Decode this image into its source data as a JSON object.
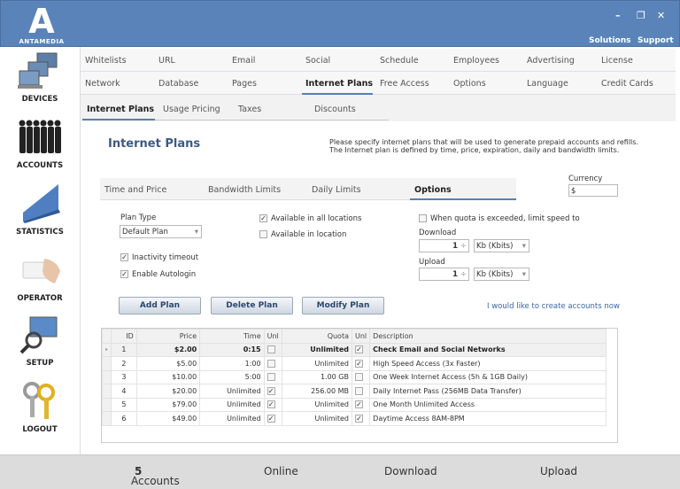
{
  "app": {
    "logo_text": "ANTAMEDIA",
    "links": [
      "Solutions",
      "Support"
    ]
  },
  "window_controls": [
    "minimize-icon",
    "restore-icon",
    "close-icon"
  ],
  "sidebar": [
    {
      "label": "DEVICES",
      "icon": "devices-icon"
    },
    {
      "label": "ACCOUNTS",
      "icon": "accounts-icon"
    },
    {
      "label": "STATISTICS",
      "icon": "statistics-icon"
    },
    {
      "label": "OPERATOR",
      "icon": "operator-icon"
    },
    {
      "label": "SETUP",
      "icon": "setup-icon"
    },
    {
      "label": "LOGOUT",
      "icon": "logout-icon"
    }
  ],
  "nav_row1": [
    "Whitelists",
    "URL",
    "Email",
    "Social",
    "Schedule",
    "Employees",
    "Advertising",
    "License"
  ],
  "nav_row2": [
    "Network",
    "Database",
    "Pages",
    "Internet Plans",
    "Free Access",
    "Options",
    "Language",
    "Credit Cards"
  ],
  "nav_active": "Internet Plans",
  "subtabs": [
    "Internet Plans",
    "Usage Pricing",
    "Taxes",
    "Discounts"
  ],
  "page": {
    "title": "Internet Plans",
    "description": [
      "Please specify internet plans that will be used to generate prepaid accounts and refills.",
      "The Internet plan is defined by time, price, expiration, daily and bandwidth limits."
    ]
  },
  "option_tabs": [
    "Time and Price",
    "Bandwidth Limits",
    "Daily Limits",
    "Options"
  ],
  "option_tab_active": "Options",
  "currency": {
    "label": "Currency",
    "value": "$"
  },
  "options": {
    "plan_type_label": "Plan Type",
    "plan_type_value": "Default Plan",
    "inactivity_timeout": {
      "label": "Inactivity timeout",
      "checked": true
    },
    "enable_autologin": {
      "label": "Enable Autologin",
      "checked": true
    },
    "all_locations": {
      "label": "Available in all locations",
      "checked": true
    },
    "in_location": {
      "label": "Available in location",
      "checked": false
    },
    "limit_speed": {
      "label": "When quota is exceeded, limit speed to",
      "checked": false
    },
    "download_label": "Download",
    "download_value": "1",
    "download_unit": "Kb (Kbits)",
    "upload_label": "Upload",
    "upload_value": "1",
    "upload_unit": "Kb (Kbits)"
  },
  "buttons": {
    "add": "Add Plan",
    "delete": "Delete Plan",
    "modify": "Modify Plan",
    "create_link": "I would like to create accounts now"
  },
  "table": {
    "columns": [
      "ID",
      "Price",
      "Time",
      "Unl",
      "Quota",
      "Unl",
      "Description"
    ],
    "rows": [
      {
        "id": "1",
        "price": "$2.00",
        "time": "0:15",
        "time_unl": false,
        "quota": "Unlimited",
        "quota_unl": true,
        "desc": "Check Email and Social Networks"
      },
      {
        "id": "2",
        "price": "$5.00",
        "time": "1:00",
        "time_unl": false,
        "quota": "Unlimited",
        "quota_unl": true,
        "desc": "High Speed Access (3x Faster)"
      },
      {
        "id": "3",
        "price": "$10.00",
        "time": "5:00",
        "time_unl": false,
        "quota": "1.00 GB",
        "quota_unl": false,
        "desc": "One Week Internet Access (5h & 1GB Daily)"
      },
      {
        "id": "4",
        "price": "$20.00",
        "time": "Unlimited",
        "time_unl": true,
        "quota": "256.00 MB",
        "quota_unl": false,
        "desc": "Daily Internet Pass (256MB Data Transfer)"
      },
      {
        "id": "5",
        "price": "$79.00",
        "time": "Unlimited",
        "time_unl": true,
        "quota": "Unlimited",
        "quota_unl": true,
        "desc": "One Month Unlimited Access"
      },
      {
        "id": "6",
        "price": "$49.00",
        "time": "Unlimited",
        "time_unl": true,
        "quota": "Unlimited",
        "quota_unl": true,
        "desc": "Daytime Access 8AM-8PM"
      }
    ]
  },
  "footer": {
    "accounts_label": "Accounts",
    "accounts_count": "5",
    "online_label": "Online",
    "download_label": "Download",
    "upload_label": "Upload"
  },
  "colors": {
    "header": "#5a84b9",
    "accent": "#5a7fb0",
    "link": "#3a66a8"
  }
}
